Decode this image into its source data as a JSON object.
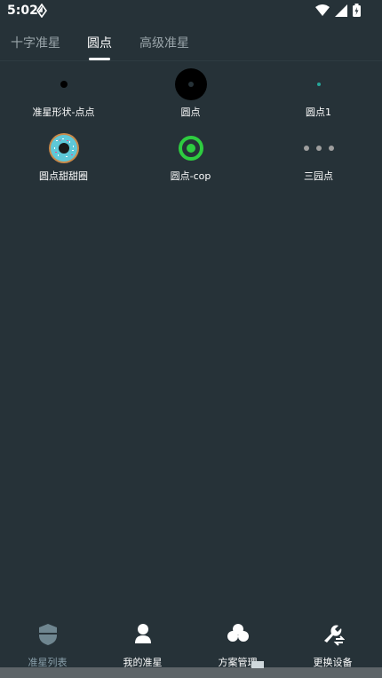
{
  "status_bar": {
    "time": "5:02"
  },
  "tabs": [
    {
      "label": "十字准星",
      "active": false
    },
    {
      "label": "圆点",
      "active": true
    },
    {
      "label": "高级准星",
      "active": false
    }
  ],
  "grid_items": [
    {
      "label": "准星形状-点点",
      "icon": "small-black-dot-icon"
    },
    {
      "label": "圆点",
      "icon": "black-circle-dot-icon"
    },
    {
      "label": "圆点1",
      "icon": "tiny-teal-dot-icon"
    },
    {
      "label": "圆点甜甜圈",
      "icon": "donut-icon"
    },
    {
      "label": "圆点-cop",
      "icon": "green-ring-dot-icon"
    },
    {
      "label": "三园点",
      "icon": "three-dots-icon"
    }
  ],
  "bottom_nav": [
    {
      "label": "准星列表",
      "icon": "shield-icon",
      "active": true
    },
    {
      "label": "我的准星",
      "icon": "user-icon",
      "active": false
    },
    {
      "label": "方案管理",
      "icon": "cluster-icon",
      "active": false
    },
    {
      "label": "更换设备",
      "icon": "wrench-swap-icon",
      "active": false
    }
  ],
  "colors": {
    "background": "#263238",
    "accent_green": "#2ecc40",
    "teal": "#26a69a",
    "inactive": "#9aa5aa"
  }
}
